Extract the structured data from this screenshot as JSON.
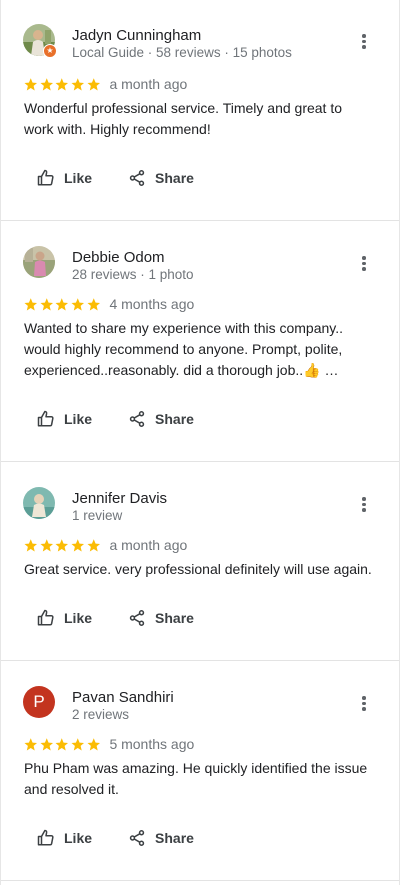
{
  "reviews": [
    {
      "name": "Jadyn Cunningham",
      "meta": "Local Guide · 58 reviews · 15 photos",
      "stars": 5,
      "time": "a month ago",
      "text": "Wonderful professional service. Timely and great to work with. Highly recommend!",
      "like_label": "Like",
      "share_label": "Share"
    },
    {
      "name": "Debbie Odom",
      "meta": "28 reviews · 1 photo",
      "stars": 5,
      "time": "4 months ago",
      "text": "Wanted to share my experience with this company.. would highly recommend to anyone. Prompt, polite, experienced..reasonably. did a thorough job..👍 …",
      "like_label": "Like",
      "share_label": "Share"
    },
    {
      "name": "Jennifer Davis",
      "meta": "1 review",
      "stars": 5,
      "time": "a month ago",
      "text": "Great service. very professional definitely will use again.",
      "like_label": "Like",
      "share_label": "Share"
    },
    {
      "name": "Pavan Sandhiri",
      "avatar_letter": "P",
      "meta": "2 reviews",
      "stars": 5,
      "time": "5 months ago",
      "text": "Phu Pham was amazing. He quickly identified the issue and resolved it.",
      "like_label": "Like",
      "share_label": "Share"
    }
  ],
  "colors": {
    "star": "#fbbc04",
    "avatar_letter_bg": "#c3341f",
    "local_guide_badge": "#e8702a"
  }
}
